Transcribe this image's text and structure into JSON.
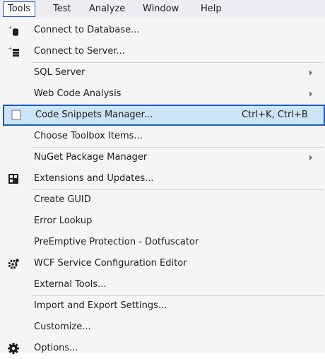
{
  "menubar": {
    "items": [
      {
        "label": "Tools"
      },
      {
        "label": "Test"
      },
      {
        "label": "Analyze"
      },
      {
        "label": "Window"
      },
      {
        "label": "Help"
      }
    ]
  },
  "dropdown": {
    "items": [
      {
        "label": "Connect to Database...",
        "icon": "database-plus-icon"
      },
      {
        "label": "Connect to Server...",
        "icon": "server-plus-icon"
      },
      {
        "label": "SQL Server",
        "submenu": true
      },
      {
        "label": "Web Code Analysis",
        "submenu": true
      },
      {
        "label": "Code Snippets Manager...",
        "shortcut": "Ctrl+K, Ctrl+B",
        "icon": "snippet-icon",
        "highlighted": true
      },
      {
        "label": "Choose Toolbox Items..."
      },
      {
        "label": "NuGet Package Manager",
        "submenu": true
      },
      {
        "label": "Extensions and Updates...",
        "icon": "extensions-icon"
      },
      {
        "label": "Create GUID"
      },
      {
        "label": "Error Lookup"
      },
      {
        "label": "PreEmptive Protection - Dotfuscator"
      },
      {
        "label": "WCF Service Configuration Editor",
        "icon": "wcf-config-icon"
      },
      {
        "label": "External Tools..."
      },
      {
        "label": "Import and Export Settings..."
      },
      {
        "label": "Customize..."
      },
      {
        "label": "Options...",
        "icon": "gear-icon"
      }
    ]
  },
  "colors": {
    "accent_border": "#1c57c6",
    "highlight_bg": "#cce4f7",
    "menu_bg": "#f5f5f5",
    "menubar_bg": "#eeeef2"
  }
}
